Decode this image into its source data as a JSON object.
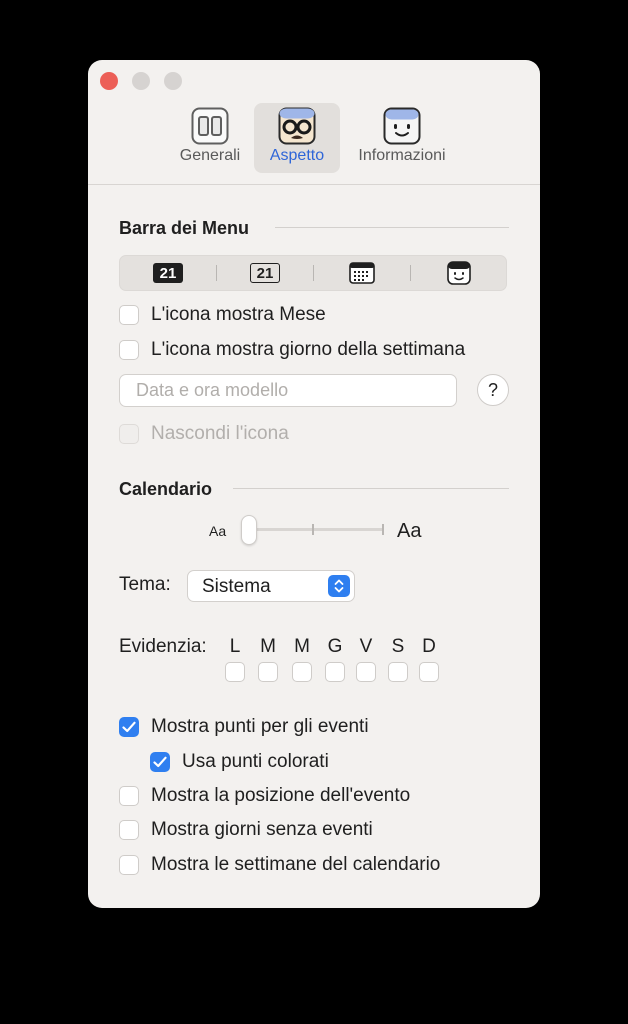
{
  "toolbar": {
    "tabs": [
      {
        "label": "Generali",
        "icon": "general-icon"
      },
      {
        "label": "Aspetto",
        "icon": "glasses-face-icon"
      },
      {
        "label": "Informazioni",
        "icon": "smiley-face-icon"
      }
    ],
    "active_tab": "Aspetto"
  },
  "menu_bar": {
    "heading": "Barra dei Menu",
    "icon_styles": [
      {
        "label": "21",
        "style": "filled"
      },
      {
        "label": "21",
        "style": "outline"
      },
      {
        "label": "",
        "style": "calendar-grid-icon"
      },
      {
        "label": "",
        "style": "face-icon"
      }
    ],
    "show_month_label": "L'icona mostra Mese",
    "show_weekday_label": "L'icona mostra giorno della settimana",
    "template_placeholder": "Data e ora modello",
    "help_label": "?",
    "hide_icon_label": "Nascondi l'icona"
  },
  "calendar": {
    "heading": "Calendario",
    "font_small_label": "Aa",
    "font_large_label": "Aa",
    "theme_label": "Tema:",
    "theme_value": "Sistema",
    "highlight_label": "Evidenzia:",
    "days": [
      "L",
      "M",
      "M",
      "G",
      "V",
      "S",
      "D"
    ],
    "options": {
      "show_event_dots": {
        "label": "Mostra punti per gli eventi",
        "checked": true
      },
      "use_colored_dots": {
        "label": "Usa punti colorati",
        "checked": true
      },
      "show_event_location": {
        "label": "Mostra la posizione dell'evento",
        "checked": false
      },
      "show_days_without_events": {
        "label": "Mostra giorni senza eventi",
        "checked": false
      },
      "show_calendar_weeks": {
        "label": "Mostra le settimane del calendario",
        "checked": false
      }
    }
  },
  "colors": {
    "accent": "#2f7ff0",
    "active_tab_text": "#2f66d8",
    "close_button": "#ec5f57"
  }
}
